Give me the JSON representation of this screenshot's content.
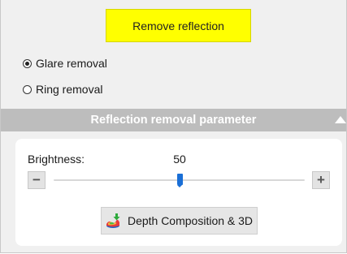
{
  "actions": {
    "remove_reflection_label": "Remove reflection"
  },
  "modes": [
    {
      "label": "Glare removal",
      "checked": true
    },
    {
      "label": "Ring removal",
      "checked": false
    }
  ],
  "section": {
    "title": "Reflection removal parameter",
    "collapse_icon": "triangle-up-icon"
  },
  "brightness": {
    "label": "Brightness:",
    "value": "50",
    "level": 0.5,
    "minus_label": "−",
    "plus_label": "+"
  },
  "depth": {
    "label": "Depth Composition & 3D",
    "icon": "depth-3d-icon"
  },
  "colors": {
    "accent_yellow": "#ffff00",
    "header_gray": "#bdbdbd",
    "slider_blue": "#1a6fd6"
  }
}
